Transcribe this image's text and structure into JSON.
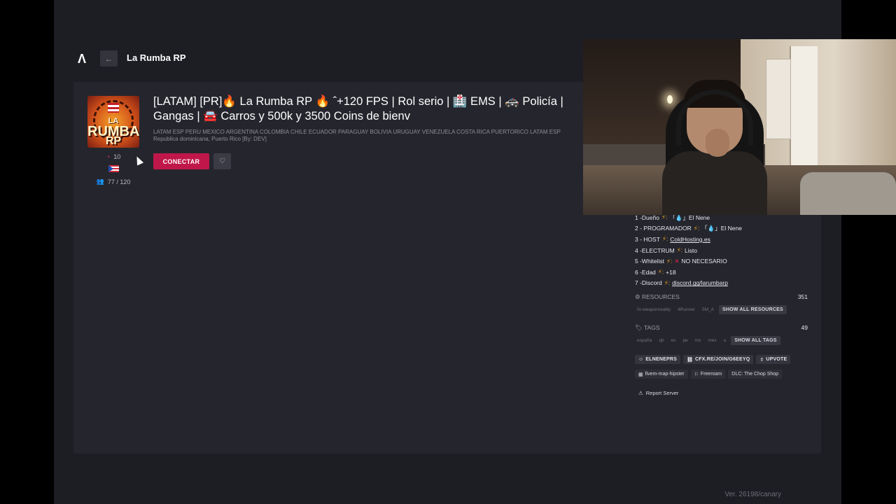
{
  "app": {
    "logo": "Λ",
    "back_icon": "←",
    "title": "La Rumba RP",
    "version": "Ver. 26198/canary"
  },
  "server": {
    "icon_text_top": "LA",
    "icon_text_mid": "RUMBA",
    "icon_text_bottom": "RP",
    "name": "[LATAM] [PR]🔥 La Rumba RP 🔥 ˆ+120 FPS | Rol serio | 🏥 EMS | 🚓 Policía | Gangas | 🚘 Carros y 500k y 3500 Coins de bienv",
    "description": "LATAM ESP PERU MEXICO ARGENTINA COLOMBIA CHILE ECUADOR PARAGUAY BOLIVIA URUGUAY VENEZUELA COSTA RICA PUERTORICO LATAM ESP Republica dominicana, Puerto Rico [By: DEV]",
    "upvotes": "10",
    "players": "77 / 120",
    "connect_label": "CONECTAR",
    "favorite_icon": "♡"
  },
  "info": [
    {
      "label": "1 -Dueño",
      "value": "「💧」El Nene",
      "link": false
    },
    {
      "label": "2 - PROGRAMADOR",
      "value": "「💧」El Nene",
      "link": false
    },
    {
      "label": "3 - HOST",
      "value": "ColdHosting.es",
      "link": true
    },
    {
      "label": "4 -ELECTRUM",
      "value": "Listo",
      "link": false
    },
    {
      "label": "5 -Whitelist",
      "value": "NO NECESARIO",
      "link": false,
      "cross": "✕"
    },
    {
      "label": "6 -Edad",
      "value": "+18",
      "link": false
    },
    {
      "label": "7 -Discord",
      "value": "discord.gg/larumbarp",
      "link": true
    }
  ],
  "resources": {
    "label": "RESOURCES",
    "count": "351",
    "items": [
      "0r-weaponreality",
      "4Runner",
      "5M_A"
    ],
    "show_all": "SHOW ALL RESOURCES"
  },
  "tags": {
    "label": "TAGS",
    "count": "49",
    "items": [
      "españa",
      "qb",
      "es",
      "pe",
      "mx",
      "mex",
      "u"
    ],
    "show_all": "SHOW ALL TAGS"
  },
  "links": [
    {
      "icon": "discord-icon",
      "label": "ELNENEPRS"
    },
    {
      "icon": "link-icon",
      "label": "CFX.RE/JOIN/G6EEYQ"
    },
    {
      "icon": "upvote-icon",
      "label": "UPVOTE"
    }
  ],
  "badges": [
    {
      "icon": "map-icon",
      "label": "fivem-map-hipster"
    },
    {
      "icon": "gamemode-icon",
      "label": "Freeroam"
    },
    {
      "icon": "",
      "label": "DLC: The Chop Shop"
    }
  ],
  "report": "Report Server",
  "colors": {
    "accent": "#c0174a",
    "background": "#1d1e24",
    "panel": "#25262d"
  }
}
